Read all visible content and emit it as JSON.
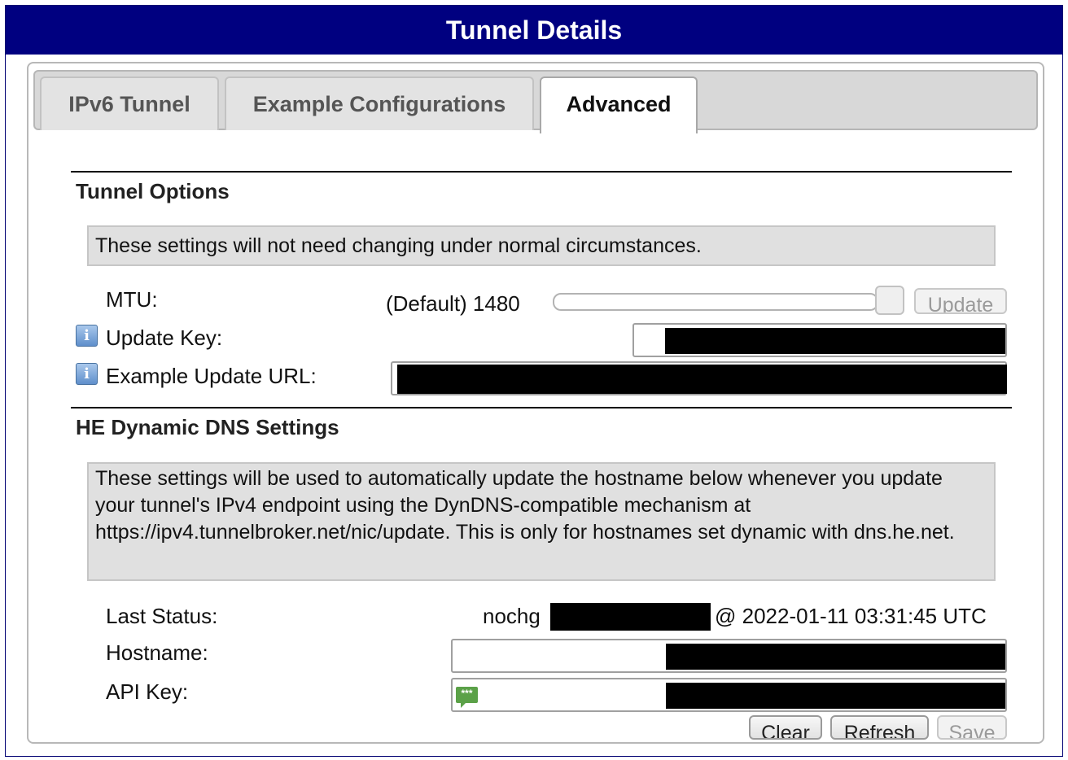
{
  "window": {
    "title": "Tunnel Details"
  },
  "tabs": [
    {
      "label": "IPv6 Tunnel",
      "active": false
    },
    {
      "label": "Example Configurations",
      "active": false
    },
    {
      "label": "Advanced",
      "active": true
    }
  ],
  "tunnel_options": {
    "title": "Tunnel Options",
    "notice": "These settings will not need changing under normal circumstances.",
    "mtu": {
      "label": "MTU:",
      "value": "(Default) 1480",
      "slider_level": 1.0,
      "update_label": "Update"
    },
    "update_key": {
      "label": "Update Key:",
      "info_icon": "info-icon"
    },
    "example_update_url": {
      "label": "Example Update URL:",
      "info_icon": "info-icon"
    }
  },
  "dyndns": {
    "title": "HE Dynamic DNS Settings",
    "notice": "These settings will be used to automatically update the hostname below whenever you update your tunnel's IPv4 endpoint using the DynDNS-compatible mechanism at https://ipv4.tunnelbroker.net/nic/update. This is only for hostnames set dynamic with dns.he.net.",
    "last_status": {
      "label": "Last Status:",
      "status": "nochg",
      "timestamp": "@ 2022-01-11 03:31:45 UTC"
    },
    "hostname": {
      "label": "Hostname:"
    },
    "api_key": {
      "label": "API Key:",
      "icon": "password-chat-icon",
      "icon_text": "***"
    },
    "buttons": {
      "clear": "Clear",
      "refresh": "Refresh",
      "save": "Save"
    }
  },
  "colors": {
    "titlebar": "#000080",
    "notice_bg": "#e0e0e0",
    "redaction": "#000000"
  }
}
